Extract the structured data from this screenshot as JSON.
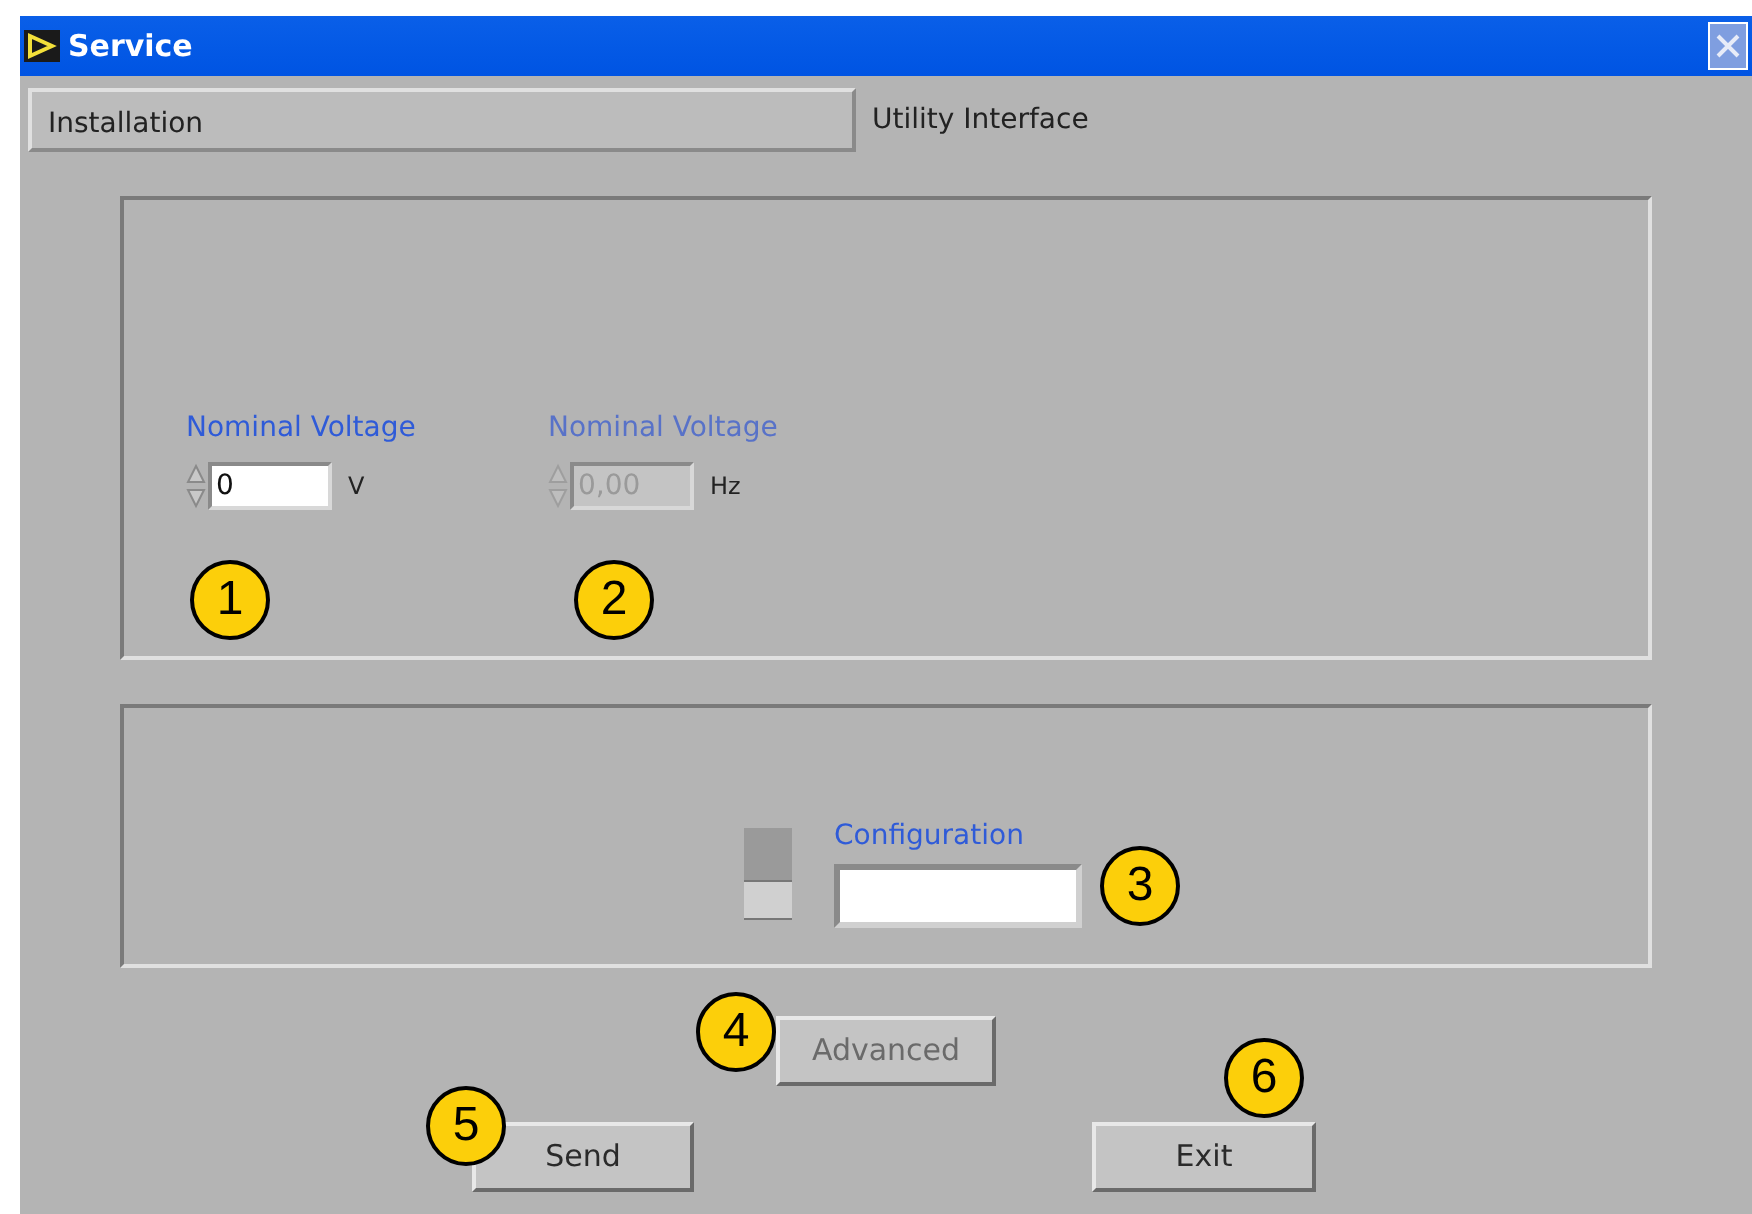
{
  "window": {
    "title": "Service"
  },
  "tabs": [
    {
      "label": "Installation",
      "selected": false
    },
    {
      "label": "Utility Interface",
      "selected": true
    }
  ],
  "fields": [
    {
      "label": "Nominal Voltage",
      "value": "0",
      "unit": "V",
      "disabled": false
    },
    {
      "label": "Nominal Voltage",
      "value": "0,00",
      "unit": "Hz",
      "disabled": true
    }
  ],
  "switch": {
    "on": false
  },
  "configuration": {
    "label": "Configuration"
  },
  "buttons": [
    {
      "label": "Advanced",
      "disabled": true
    },
    {
      "label": "Send",
      "disabled": false
    },
    {
      "label": "Exit",
      "disabled": false
    }
  ],
  "callouts": [
    "1",
    "2",
    "3",
    "4",
    "5",
    "6"
  ]
}
